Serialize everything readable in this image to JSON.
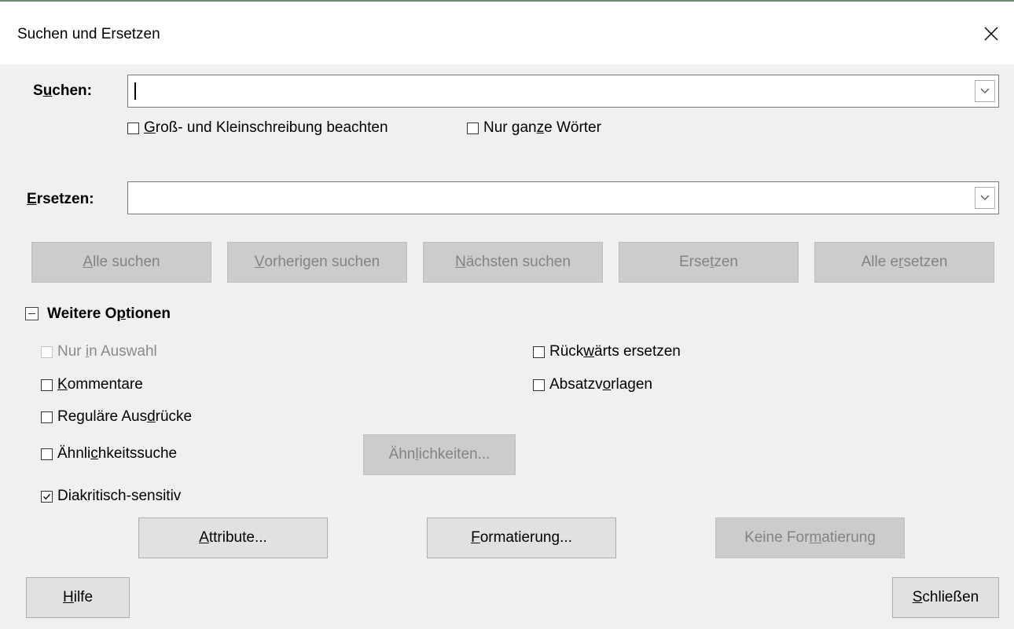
{
  "window": {
    "title": "Suchen und Ersetzen",
    "close_icon": "close-icon"
  },
  "search": {
    "label_pre": "S",
    "label_ul": "u",
    "label_post": "chen:",
    "value": "",
    "match_case": {
      "pre": "",
      "ul": "G",
      "post": "roß- und Kleinschreibung beachten",
      "checked": false
    },
    "whole_words": {
      "pre": "Nur gan",
      "ul": "z",
      "post": "e Wörter",
      "checked": false
    }
  },
  "replace": {
    "label_pre": "",
    "label_ul": "E",
    "label_post": "rsetzen:",
    "value": ""
  },
  "actions": {
    "find_all": {
      "pre": "",
      "ul": "A",
      "post": "lle suchen"
    },
    "find_prev": {
      "pre": "",
      "ul": "V",
      "post": "orherigen suchen"
    },
    "find_next": {
      "pre": "",
      "ul": "N",
      "post": "ächsten suchen"
    },
    "replace": {
      "pre": "Erse",
      "ul": "t",
      "post": "zen"
    },
    "replace_all": {
      "pre": "Alle e",
      "ul": "r",
      "post": "setzen"
    }
  },
  "options": {
    "header_pre": "Weitere O",
    "header_ul": "p",
    "header_post": "tionen",
    "current_selection": {
      "pre": "Nur ",
      "ul": "i",
      "post": "n Auswahl",
      "checked": false
    },
    "comments": {
      "pre": "",
      "ul": "K",
      "post": "ommentare",
      "checked": false
    },
    "regex": {
      "pre": "Reguläre Aus",
      "ul": "d",
      "post": "rücke",
      "checked": false
    },
    "similarity": {
      "pre": "Ähnli",
      "ul": "c",
      "post": "hkeitssuche",
      "checked": false
    },
    "similarities_button": {
      "pre": "Ähn",
      "ul": "l",
      "post": "ichkeiten..."
    },
    "diacritics": {
      "pre": "Diakritisch-sensitiv",
      "ul": "",
      "post": "",
      "checked": true
    },
    "replace_backwards": {
      "pre": "Rück",
      "ul": "w",
      "post": "ärts ersetzen",
      "checked": false
    },
    "paragraph_styles": {
      "pre": "Absatzv",
      "ul": "o",
      "post": "rlagen",
      "checked": false
    },
    "attributes_button": {
      "pre": "",
      "ul": "A",
      "post": "ttribute..."
    },
    "format_button": {
      "pre": "",
      "ul": "F",
      "post": "ormatierung..."
    },
    "no_format_button": {
      "pre": "Keine For",
      "ul": "m",
      "post": "atierung"
    }
  },
  "footer": {
    "help": {
      "pre": "",
      "ul": "H",
      "post": "ilfe"
    },
    "close": {
      "pre": "",
      "ul": "S",
      "post": "chließen"
    }
  }
}
